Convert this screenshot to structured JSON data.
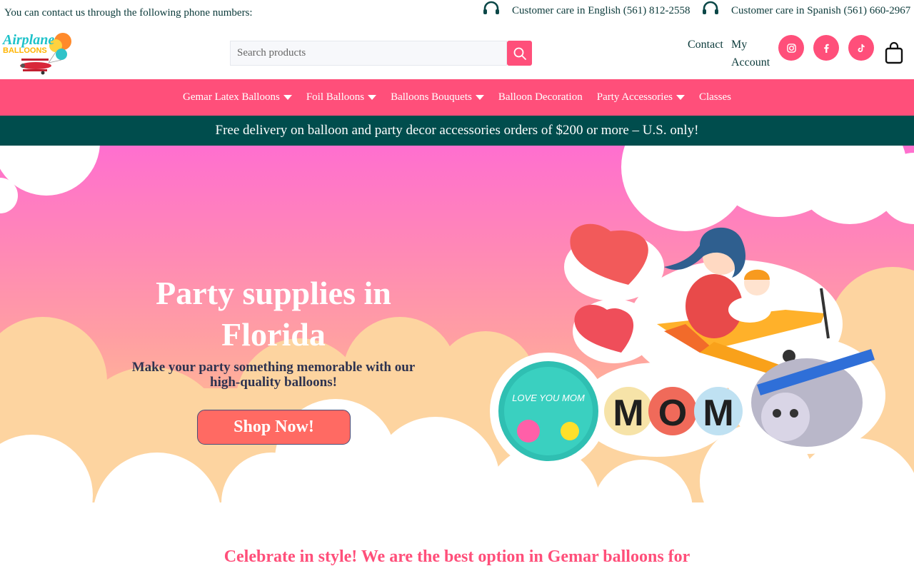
{
  "topbar": {
    "intro": "You can contact us through the following phone numbers:",
    "care_english": "Customer care in English (561) 812-2558",
    "care_spanish": "Customer care in Spanish (561) 660-2967"
  },
  "header": {
    "logo_text_top": "Airplane",
    "logo_text_bottom": "BALLOONS",
    "search_placeholder": "Search products",
    "contact_label": "Contact",
    "account_label": "My Account",
    "social": [
      "instagram-icon",
      "facebook-icon",
      "tiktok-icon"
    ]
  },
  "nav": {
    "items": [
      {
        "label": "Gemar Latex Balloons",
        "dropdown": true
      },
      {
        "label": "Foil Balloons",
        "dropdown": true
      },
      {
        "label": "Balloons Bouquets",
        "dropdown": true
      },
      {
        "label": "Balloon Decoration",
        "dropdown": false
      },
      {
        "label": "Party Accessories",
        "dropdown": true
      },
      {
        "label": "Classes",
        "dropdown": false
      }
    ]
  },
  "promo": {
    "text": "Free delivery on balloon and party decor accessories orders of $200 or more – U.S. only!"
  },
  "hero": {
    "title": "Party supplies in Florida",
    "subtitle": "Make your party something memorable with our high-quality balloons!",
    "cta": "Shop Now!",
    "balloon_letters": [
      "M",
      "O",
      "M"
    ],
    "round_balloon_text": "LOVE YOU MOM"
  },
  "section": {
    "heading": "Celebrate in style! We are the best option in Gemar balloons for"
  },
  "colors": {
    "accent_pink": "#ff4f7a",
    "dark_teal": "#004d4d",
    "cta_coral": "#ff6a63"
  }
}
